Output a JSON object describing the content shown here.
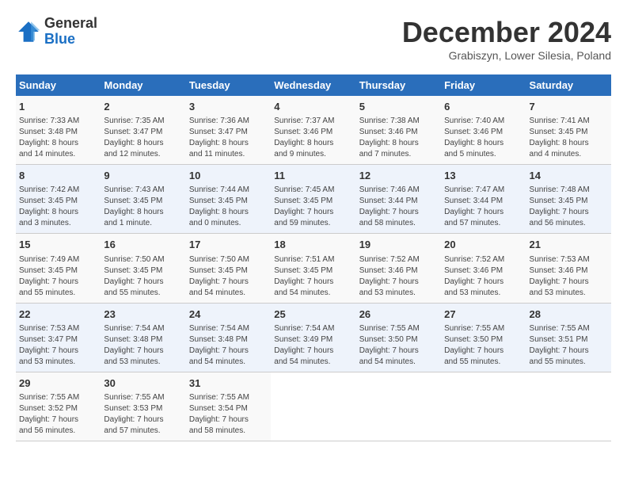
{
  "header": {
    "logo_general": "General",
    "logo_blue": "Blue",
    "title": "December 2024",
    "subtitle": "Grabiszyn, Lower Silesia, Poland"
  },
  "columns": [
    "Sunday",
    "Monday",
    "Tuesday",
    "Wednesday",
    "Thursday",
    "Friday",
    "Saturday"
  ],
  "weeks": [
    [
      {
        "day": "1",
        "info": "Sunrise: 7:33 AM\nSunset: 3:48 PM\nDaylight: 8 hours\nand 14 minutes."
      },
      {
        "day": "2",
        "info": "Sunrise: 7:35 AM\nSunset: 3:47 PM\nDaylight: 8 hours\nand 12 minutes."
      },
      {
        "day": "3",
        "info": "Sunrise: 7:36 AM\nSunset: 3:47 PM\nDaylight: 8 hours\nand 11 minutes."
      },
      {
        "day": "4",
        "info": "Sunrise: 7:37 AM\nSunset: 3:46 PM\nDaylight: 8 hours\nand 9 minutes."
      },
      {
        "day": "5",
        "info": "Sunrise: 7:38 AM\nSunset: 3:46 PM\nDaylight: 8 hours\nand 7 minutes."
      },
      {
        "day": "6",
        "info": "Sunrise: 7:40 AM\nSunset: 3:46 PM\nDaylight: 8 hours\nand 5 minutes."
      },
      {
        "day": "7",
        "info": "Sunrise: 7:41 AM\nSunset: 3:45 PM\nDaylight: 8 hours\nand 4 minutes."
      }
    ],
    [
      {
        "day": "8",
        "info": "Sunrise: 7:42 AM\nSunset: 3:45 PM\nDaylight: 8 hours\nand 3 minutes."
      },
      {
        "day": "9",
        "info": "Sunrise: 7:43 AM\nSunset: 3:45 PM\nDaylight: 8 hours\nand 1 minute."
      },
      {
        "day": "10",
        "info": "Sunrise: 7:44 AM\nSunset: 3:45 PM\nDaylight: 8 hours\nand 0 minutes."
      },
      {
        "day": "11",
        "info": "Sunrise: 7:45 AM\nSunset: 3:45 PM\nDaylight: 7 hours\nand 59 minutes."
      },
      {
        "day": "12",
        "info": "Sunrise: 7:46 AM\nSunset: 3:44 PM\nDaylight: 7 hours\nand 58 minutes."
      },
      {
        "day": "13",
        "info": "Sunrise: 7:47 AM\nSunset: 3:44 PM\nDaylight: 7 hours\nand 57 minutes."
      },
      {
        "day": "14",
        "info": "Sunrise: 7:48 AM\nSunset: 3:45 PM\nDaylight: 7 hours\nand 56 minutes."
      }
    ],
    [
      {
        "day": "15",
        "info": "Sunrise: 7:49 AM\nSunset: 3:45 PM\nDaylight: 7 hours\nand 55 minutes."
      },
      {
        "day": "16",
        "info": "Sunrise: 7:50 AM\nSunset: 3:45 PM\nDaylight: 7 hours\nand 55 minutes."
      },
      {
        "day": "17",
        "info": "Sunrise: 7:50 AM\nSunset: 3:45 PM\nDaylight: 7 hours\nand 54 minutes."
      },
      {
        "day": "18",
        "info": "Sunrise: 7:51 AM\nSunset: 3:45 PM\nDaylight: 7 hours\nand 54 minutes."
      },
      {
        "day": "19",
        "info": "Sunrise: 7:52 AM\nSunset: 3:46 PM\nDaylight: 7 hours\nand 53 minutes."
      },
      {
        "day": "20",
        "info": "Sunrise: 7:52 AM\nSunset: 3:46 PM\nDaylight: 7 hours\nand 53 minutes."
      },
      {
        "day": "21",
        "info": "Sunrise: 7:53 AM\nSunset: 3:46 PM\nDaylight: 7 hours\nand 53 minutes."
      }
    ],
    [
      {
        "day": "22",
        "info": "Sunrise: 7:53 AM\nSunset: 3:47 PM\nDaylight: 7 hours\nand 53 minutes."
      },
      {
        "day": "23",
        "info": "Sunrise: 7:54 AM\nSunset: 3:48 PM\nDaylight: 7 hours\nand 53 minutes."
      },
      {
        "day": "24",
        "info": "Sunrise: 7:54 AM\nSunset: 3:48 PM\nDaylight: 7 hours\nand 54 minutes."
      },
      {
        "day": "25",
        "info": "Sunrise: 7:54 AM\nSunset: 3:49 PM\nDaylight: 7 hours\nand 54 minutes."
      },
      {
        "day": "26",
        "info": "Sunrise: 7:55 AM\nSunset: 3:50 PM\nDaylight: 7 hours\nand 54 minutes."
      },
      {
        "day": "27",
        "info": "Sunrise: 7:55 AM\nSunset: 3:50 PM\nDaylight: 7 hours\nand 55 minutes."
      },
      {
        "day": "28",
        "info": "Sunrise: 7:55 AM\nSunset: 3:51 PM\nDaylight: 7 hours\nand 55 minutes."
      }
    ],
    [
      {
        "day": "29",
        "info": "Sunrise: 7:55 AM\nSunset: 3:52 PM\nDaylight: 7 hours\nand 56 minutes."
      },
      {
        "day": "30",
        "info": "Sunrise: 7:55 AM\nSunset: 3:53 PM\nDaylight: 7 hours\nand 57 minutes."
      },
      {
        "day": "31",
        "info": "Sunrise: 7:55 AM\nSunset: 3:54 PM\nDaylight: 7 hours\nand 58 minutes."
      },
      null,
      null,
      null,
      null
    ]
  ]
}
